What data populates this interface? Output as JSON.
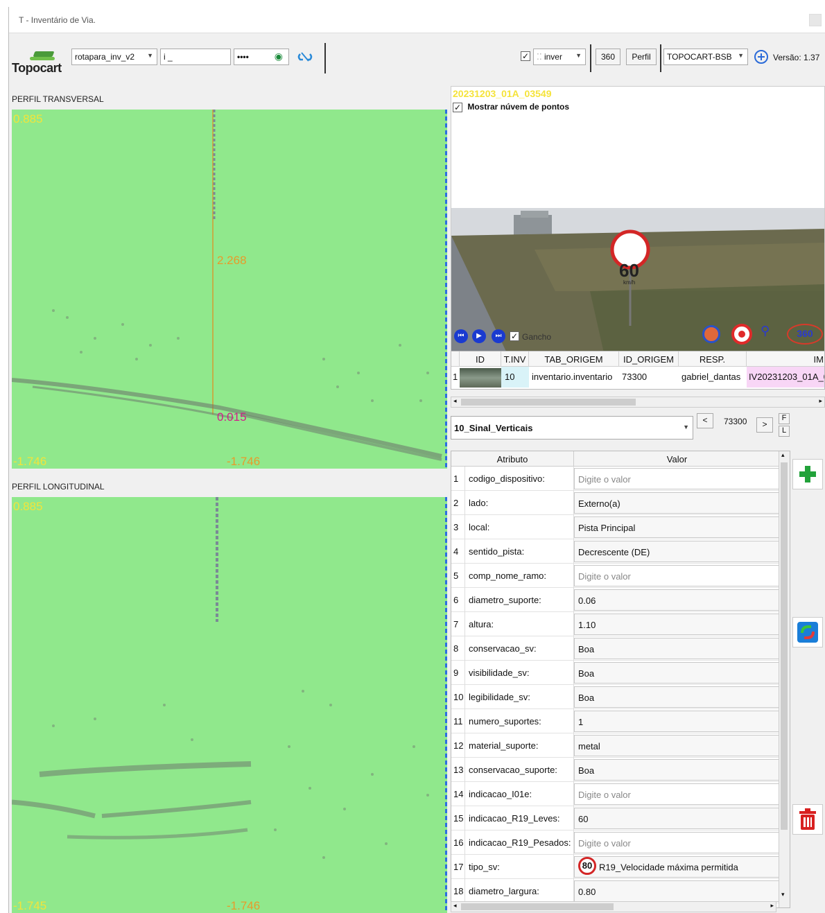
{
  "window": {
    "title": "T - Inventário de Via."
  },
  "toolbar": {
    "logo_text": "Topocart",
    "project_combo": "rotapara_inv_v2",
    "user_field": "i _",
    "password_field": "••••",
    "inver_combo": "inver",
    "btn_360": "360",
    "btn_perfil": "Perfil",
    "server_combo": "TOPOCART-BSB",
    "version_label": "Versão: 1.37"
  },
  "transversal": {
    "label": "PERFIL TRANSVERSAL",
    "top_value": "0.885",
    "mid_value": "2.268",
    "low_value": "0.015",
    "bottom_left": "-1.746",
    "bottom_right": "-1.746"
  },
  "longitudinal": {
    "label": "PERFIL LONGITUDINAL",
    "top_value": "0.885",
    "bottom_left": "-1.745",
    "bottom_right": "-1.746"
  },
  "viewer": {
    "code": "20231203_01A_03549",
    "show_cloud_label": "Mostrar núvem de pontos",
    "sign_value": "60",
    "sign_unit": "km/h",
    "gancho_label": "Gancho",
    "icon_360": "360"
  },
  "grid": {
    "headers": [
      "ID",
      "T.INV",
      "TAB_ORIGEM",
      "ID_ORIGEM",
      "RESP.",
      "IM"
    ],
    "row": {
      "num": "1",
      "tinv": "10",
      "tab_origem": "inventario.inventario",
      "id_origem": "73300",
      "resp": "gabriel_dantas",
      "im": "IV20231203_01A_0"
    }
  },
  "layer": {
    "combo": "10_Sinal_Verticais",
    "prev": "<",
    "id": "73300",
    "next": ">",
    "first": "F",
    "last": "L"
  },
  "attributes": {
    "header_attr": "Atributo",
    "header_val": "Valor",
    "placeholder": "Digite o valor",
    "rows": [
      {
        "num": "1",
        "name": "codigo_dispositivo:",
        "value": "Digite o valor",
        "ph": true
      },
      {
        "num": "2",
        "name": "lado:",
        "value": "Externo(a)",
        "ph": false
      },
      {
        "num": "3",
        "name": "local:",
        "value": "Pista Principal",
        "ph": false
      },
      {
        "num": "4",
        "name": "sentido_pista:",
        "value": "Decrescente (DE)",
        "ph": false
      },
      {
        "num": "5",
        "name": "comp_nome_ramo:",
        "value": "Digite o valor",
        "ph": true
      },
      {
        "num": "6",
        "name": "diametro_suporte:",
        "value": "0.06",
        "ph": false
      },
      {
        "num": "7",
        "name": "altura:",
        "value": "1.10",
        "ph": false
      },
      {
        "num": "8",
        "name": "conservacao_sv:",
        "value": "Boa",
        "ph": false
      },
      {
        "num": "9",
        "name": "visibilidade_sv:",
        "value": "Boa",
        "ph": false
      },
      {
        "num": "10",
        "name": "legibilidade_sv:",
        "value": "Boa",
        "ph": false
      },
      {
        "num": "11",
        "name": "numero_suportes:",
        "value": "1",
        "ph": false
      },
      {
        "num": "12",
        "name": "material_suporte:",
        "value": "metal",
        "ph": false
      },
      {
        "num": "13",
        "name": "conservacao_suporte:",
        "value": "Boa",
        "ph": false
      },
      {
        "num": "14",
        "name": "indicacao_I01e:",
        "value": "Digite o valor",
        "ph": true
      },
      {
        "num": "15",
        "name": "indicacao_R19_Leves:",
        "value": "60",
        "ph": false
      },
      {
        "num": "16",
        "name": "indicacao_R19_Pesados:",
        "value": "Digite o valor",
        "ph": true
      },
      {
        "num": "17",
        "name": "tipo_sv:",
        "value": "R19_Velocidade máxima permitida",
        "ph": false,
        "sign": "80"
      },
      {
        "num": "18",
        "name": "diametro_largura:",
        "value": "0.80",
        "ph": false
      }
    ]
  },
  "icons": [
    "plus-icon",
    "refresh-icon",
    "trash-icon",
    "eye-icon",
    "link-icon",
    "add-circle-icon"
  ]
}
